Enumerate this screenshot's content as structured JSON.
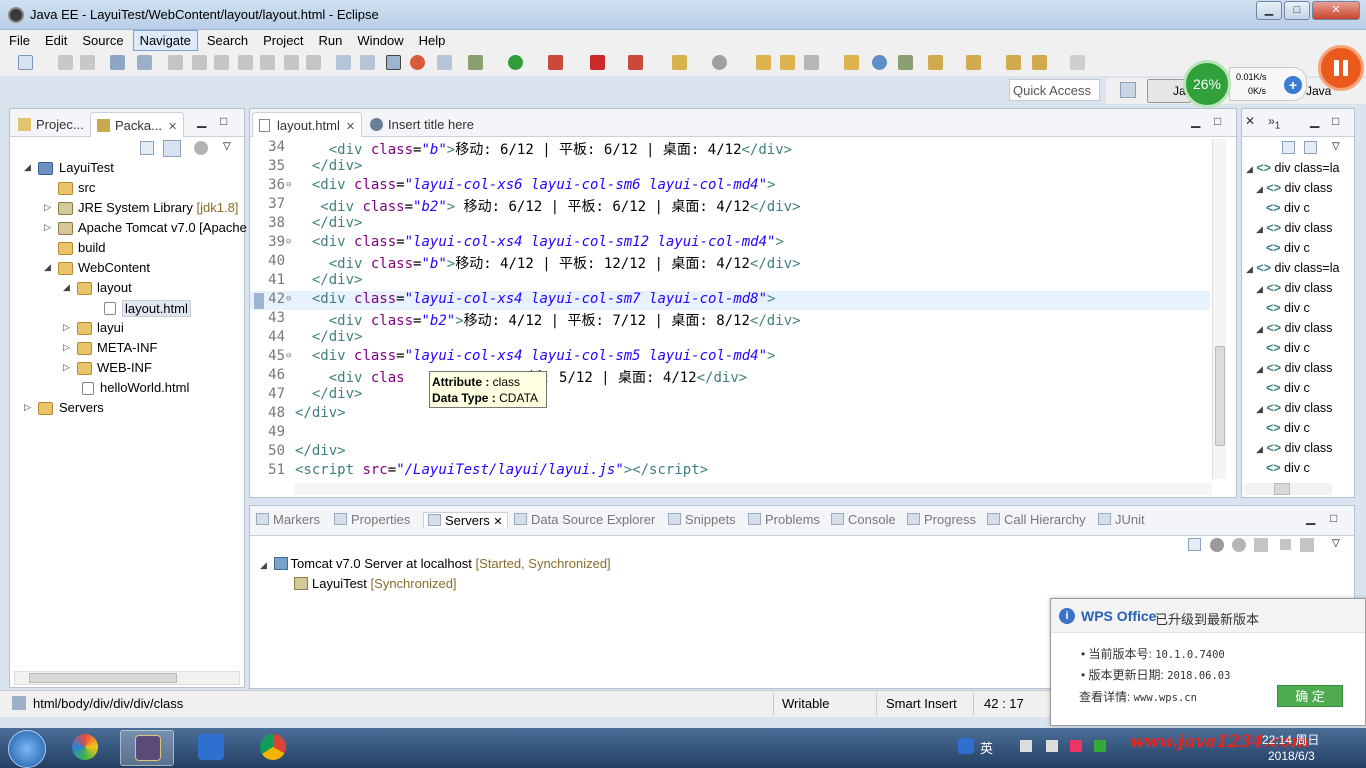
{
  "window": {
    "title": "Java EE - LayuiTest/WebContent/layout/layout.html - Eclipse",
    "minimize": "▁",
    "maximize": "□",
    "close": "✕"
  },
  "menu": [
    "File",
    "Edit",
    "Source",
    "Navigate",
    "Search",
    "Project",
    "Run",
    "Window",
    "Help"
  ],
  "toolbar": {
    "quick_access_placeholder": "Quick Access",
    "perspective_label": "Ja",
    "perspective2": "Java"
  },
  "speed_widget": {
    "percent": "26%",
    "up": "0.01K/s",
    "down": "0K/s",
    "plus": "+"
  },
  "left_panel": {
    "tabs": [
      {
        "label": "Projec..."
      },
      {
        "label": "Packa..."
      }
    ],
    "tree": [
      {
        "label": "LayuiTest",
        "deco": ""
      },
      {
        "label": "src",
        "deco": ""
      },
      {
        "label": "JRE System Library",
        "deco": "[jdk1.8]"
      },
      {
        "label": "Apache Tomcat v7.0 [Apache",
        "deco": ""
      },
      {
        "label": "build",
        "deco": ""
      },
      {
        "label": "WebContent",
        "deco": ""
      },
      {
        "label": "layout",
        "deco": ""
      },
      {
        "label": "layout.html",
        "deco": ""
      },
      {
        "label": "layui",
        "deco": ""
      },
      {
        "label": "META-INF",
        "deco": ""
      },
      {
        "label": "WEB-INF",
        "deco": ""
      },
      {
        "label": "helloWorld.html",
        "deco": ""
      },
      {
        "label": "Servers",
        "deco": ""
      }
    ]
  },
  "editor": {
    "tabs": [
      {
        "label": "layout.html"
      },
      {
        "label": "Insert title here"
      }
    ],
    "cursor": "42 : 17"
  },
  "code_lines": [
    {
      "n": "34",
      "indent": "    ",
      "tag": "div",
      "attrval": "b",
      "text": "移动: 6/12 | 平板: 6/12 | 桌面: 4/12",
      "type": "inner"
    },
    {
      "n": "35",
      "indent": "  ",
      "close": "</div>",
      "type": "close"
    },
    {
      "n": "36",
      "indent": "  ",
      "tag": "div",
      "attrval": "layui-col-xs6 layui-col-sm6 layui-col-md4",
      "type": "open",
      "fold": "⊖"
    },
    {
      "n": "37",
      "indent": "   ",
      "tag": "div",
      "attrval": "b2",
      "text": " 移动: 6/12 | 平板: 6/12 | 桌面: 4/12",
      "type": "inner"
    },
    {
      "n": "38",
      "indent": "  ",
      "close": "</div>",
      "type": "close"
    },
    {
      "n": "39",
      "indent": "  ",
      "tag": "div",
      "attrval": "layui-col-xs4 layui-col-sm12 layui-col-md4",
      "type": "open",
      "fold": "⊖"
    },
    {
      "n": "40",
      "indent": "    ",
      "tag": "div",
      "attrval": "b",
      "text": "移动: 4/12 | 平板: 12/12 | 桌面: 4/12",
      "type": "inner"
    },
    {
      "n": "41",
      "indent": "  ",
      "close": "</div>",
      "type": "close"
    },
    {
      "n": "42",
      "indent": "  ",
      "tag": "div",
      "attrval": "layui-col-xs4 layui-col-sm7 layui-col-md8",
      "type": "open",
      "fold": "⊖",
      "current": true
    },
    {
      "n": "43",
      "indent": "    ",
      "tag": "div",
      "attrval": "b2",
      "text": "移动: 4/12 | 平板: 7/12 | 桌面: 8/12",
      "type": "inner"
    },
    {
      "n": "44",
      "indent": "  ",
      "close": "</div>",
      "type": "close"
    },
    {
      "n": "45",
      "indent": "  ",
      "tag": "div",
      "attrval": "layui-col-xs4 layui-col-sm5 layui-col-md4",
      "type": "open",
      "fold": "⊖"
    },
    {
      "n": "46",
      "indent": "    ",
      "tag": "div",
      "attrval": "",
      "text": "| 平板: 5/12 | 桌面: 4/12",
      "type": "partial",
      "partial_prefix": "clas",
      "partial_mid": "2"
    },
    {
      "n": "47",
      "indent": "  ",
      "close": "</div>",
      "type": "close"
    },
    {
      "n": "48",
      "indent": "",
      "close": "</div>",
      "type": "close"
    },
    {
      "n": "49",
      "indent": "",
      "close": "",
      "type": "close"
    },
    {
      "n": "50",
      "indent": "",
      "close": "</div>",
      "type": "close"
    },
    {
      "n": "51",
      "indent": "",
      "script": "/LayuiTest/layui/layui.js",
      "type": "script"
    }
  ],
  "tooltip": {
    "attr_label": "Attribute :",
    "attr_value": "class",
    "type_label": "Data Type :",
    "type_value": "CDATA"
  },
  "outline": {
    "rows": [
      {
        "text": "div class=la",
        "level": 0
      },
      {
        "text": "div class",
        "level": 1
      },
      {
        "text": "div c",
        "level": 2
      },
      {
        "text": "div class",
        "level": 1
      },
      {
        "text": "div c",
        "level": 2
      },
      {
        "text": "div class=la",
        "level": 0
      },
      {
        "text": "div class",
        "level": 1
      },
      {
        "text": "div c",
        "level": 2
      },
      {
        "text": "div class",
        "level": 1
      },
      {
        "text": "div c",
        "level": 2
      },
      {
        "text": "div class",
        "level": 1
      },
      {
        "text": "div c",
        "level": 2
      },
      {
        "text": "div class",
        "level": 1
      },
      {
        "text": "div c",
        "level": 2
      },
      {
        "text": "div class",
        "level": 1
      },
      {
        "text": "div c",
        "level": 2
      }
    ]
  },
  "bottom": {
    "tabs": [
      "Markers",
      "Properties",
      "Servers",
      "Data Source Explorer",
      "Snippets",
      "Problems",
      "Console",
      "Progress",
      "Call Hierarchy",
      "JUnit"
    ],
    "server": "Tomcat v7.0 Server at localhost",
    "server_state": "[Started, Synchronized]",
    "module": "LayuiTest",
    "module_state": "[Synchronized]"
  },
  "status": {
    "path": "html/body/div/div/div/class",
    "writable": "Writable",
    "insert": "Smart Insert",
    "position": "42 : 17"
  },
  "wps": {
    "brand": "WPS Office",
    "headline": "已升级到最新版本",
    "version_label": "当前版本号: ",
    "version_value": "10.1.0.7400",
    "date_label": "版本更新日期: ",
    "date_value": "2018.06.03",
    "detail_label": "查看详情: ",
    "detail_value": "www.wps.cn",
    "ok": "确 定"
  },
  "taskbar": {
    "ime": "英",
    "time": "22:14 周日",
    "date": "2018/6/3",
    "watermark": "www.java1234.com"
  }
}
